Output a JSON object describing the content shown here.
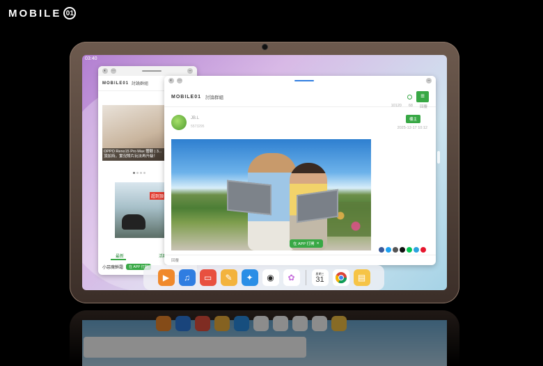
{
  "brand": {
    "text": "MOBILE",
    "logo_glyph": "01"
  },
  "status_bar": {
    "time": "03:40"
  },
  "window_left": {
    "logo": "MOBILE01",
    "section": "討論群組",
    "article_caption": "OPPO Reno15 Pro Max 體驗 | 3...\n頂加持，實況照片玩法再升級！",
    "ad_tag": "超到頂",
    "tabs": [
      "最新",
      "活動與優惠"
    ],
    "footer_text": "小惡魔鮮霜",
    "open_app": "在 APP 打開"
  },
  "window_main": {
    "logo": "MOBILE01",
    "section": "討論群組",
    "stats": [
      "10120",
      "68",
      "回覆"
    ],
    "author": "JB.L",
    "author_id": "5573295",
    "badge": "樓主",
    "post_date": "2025-12-17 10:12",
    "open_app": "在 APP 打開",
    "footer_reply": "回覆"
  },
  "dock": {
    "calendar_weekday": "星期三",
    "calendar_day": "31",
    "apps": [
      {
        "icon": "video-app-icon",
        "color": "#f0892c"
      },
      {
        "icon": "music-app-icon",
        "color": "#2f7de1"
      },
      {
        "icon": "folder-app-icon",
        "color": "#e8503f"
      },
      {
        "icon": "themes-app-icon",
        "color": "#f3b33d"
      },
      {
        "icon": "browser-app-icon",
        "color": "#2a8ee6"
      },
      {
        "icon": "camera-app-icon",
        "color": "#ffffff"
      },
      {
        "icon": "photos-app-icon",
        "color": "#c66fdc"
      },
      {
        "icon": "chrome-app-icon",
        "color": "#ffffff"
      },
      {
        "icon": "notes-app-icon",
        "color": "#f6c446"
      }
    ]
  }
}
